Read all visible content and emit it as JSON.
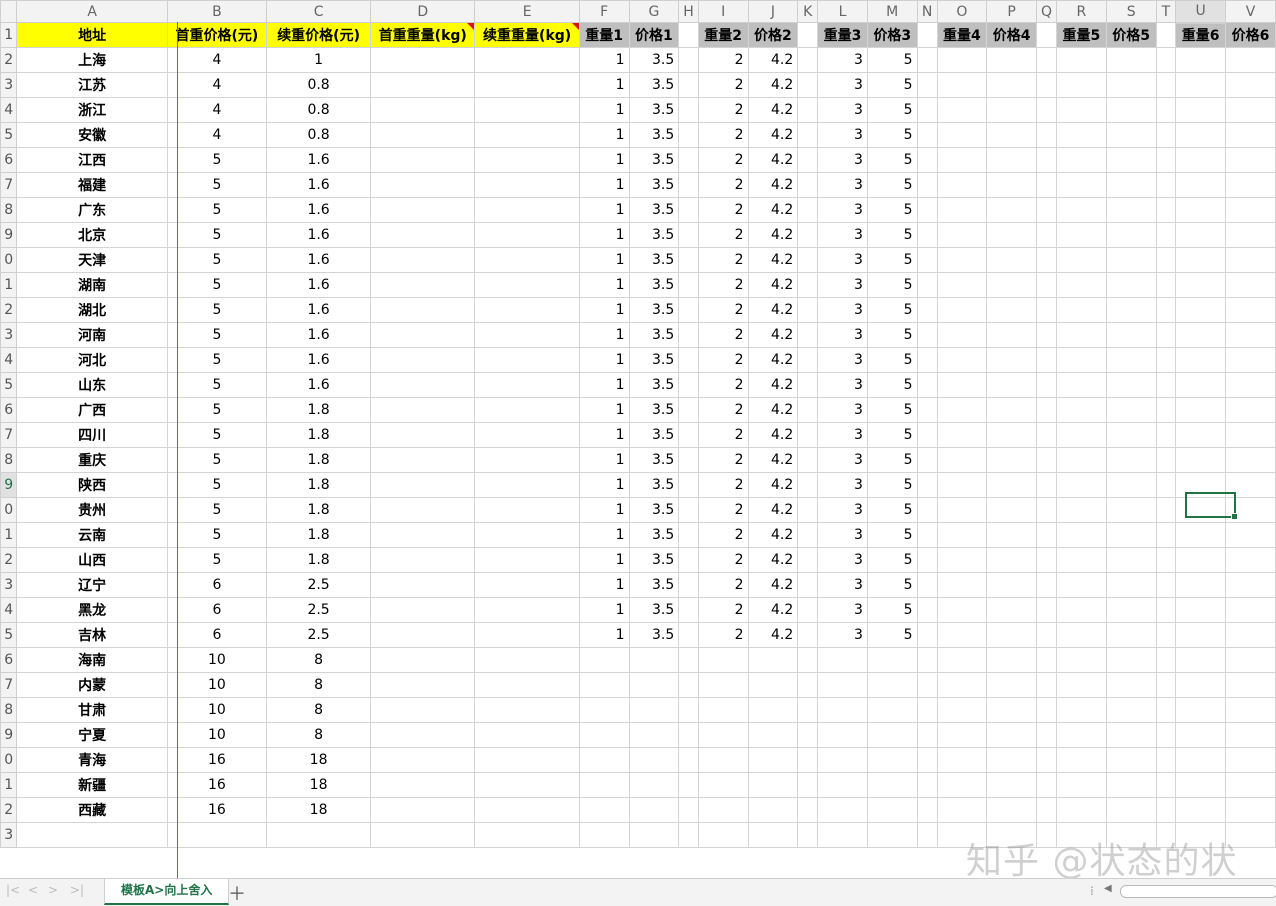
{
  "columns": [
    "A",
    "B",
    "C",
    "D",
    "E",
    "F",
    "G",
    "H",
    "I",
    "J",
    "K",
    "L",
    "M",
    "N",
    "O",
    "P",
    "Q",
    "R",
    "S",
    "T",
    "U",
    "V"
  ],
  "header_row": [
    "地址",
    "首重价格(元)",
    "续重价格(元)",
    "首重重量(kg)",
    "续重重量(kg)",
    "重量1",
    "价格1",
    "",
    "重量2",
    "价格2",
    "",
    "重量3",
    "价格3",
    "",
    "重量4",
    "价格4",
    "",
    "重量5",
    "价格5",
    "",
    "重量6",
    "价格6"
  ],
  "rows": [
    [
      "上海",
      "4",
      "1"
    ],
    [
      "江苏",
      "4",
      "0.8"
    ],
    [
      "浙江",
      "4",
      "0.8"
    ],
    [
      "安徽",
      "4",
      "0.8"
    ],
    [
      "江西",
      "5",
      "1.6"
    ],
    [
      "福建",
      "5",
      "1.6"
    ],
    [
      "广东",
      "5",
      "1.6"
    ],
    [
      "北京",
      "5",
      "1.6"
    ],
    [
      "天津",
      "5",
      "1.6"
    ],
    [
      "湖南",
      "5",
      "1.6"
    ],
    [
      "湖北",
      "5",
      "1.6"
    ],
    [
      "河南",
      "5",
      "1.6"
    ],
    [
      "河北",
      "5",
      "1.6"
    ],
    [
      "山东",
      "5",
      "1.6"
    ],
    [
      "广西",
      "5",
      "1.8"
    ],
    [
      "四川",
      "5",
      "1.8"
    ],
    [
      "重庆",
      "5",
      "1.8"
    ],
    [
      "陕西",
      "5",
      "1.8"
    ],
    [
      "贵州",
      "5",
      "1.8"
    ],
    [
      "云南",
      "5",
      "1.8"
    ],
    [
      "山西",
      "5",
      "1.8"
    ],
    [
      "辽宁",
      "6",
      "2.5"
    ],
    [
      "黑龙",
      "6",
      "2.5"
    ],
    [
      "吉林",
      "6",
      "2.5"
    ],
    [
      "海南",
      "10",
      "8"
    ],
    [
      "内蒙",
      "10",
      "8"
    ],
    [
      "甘肃",
      "10",
      "8"
    ],
    [
      "宁夏",
      "10",
      "8"
    ],
    [
      "青海",
      "16",
      "18"
    ],
    [
      "新疆",
      "16",
      "18"
    ],
    [
      "西藏",
      "16",
      "18"
    ]
  ],
  "tier_values": {
    "w1": "1",
    "p1": "3.5",
    "w2": "2",
    "p2": "4.2",
    "w3": "3",
    "p3": "5"
  },
  "tier_row_count": 24,
  "row_numbers_start": 1,
  "visible_row_labels": [
    "1",
    "2",
    "3",
    "4",
    "5",
    "6",
    "7",
    "8",
    "9",
    "0",
    "1",
    "2",
    "3",
    "4",
    "5",
    "6",
    "7",
    "8",
    "9",
    "0",
    "1",
    "2",
    "3",
    "4",
    "5",
    "6",
    "7",
    "8",
    "9",
    "0",
    "1",
    "2",
    "3"
  ],
  "selected_column": "U",
  "selected_row_label": "9",
  "sheet_tab": "模板A>向上舍入",
  "watermark": "知乎 @状态的状",
  "colors": {
    "header_yellow": "#ffff00",
    "header_gray": "#bfbfbf",
    "accent_green": "#217346"
  }
}
